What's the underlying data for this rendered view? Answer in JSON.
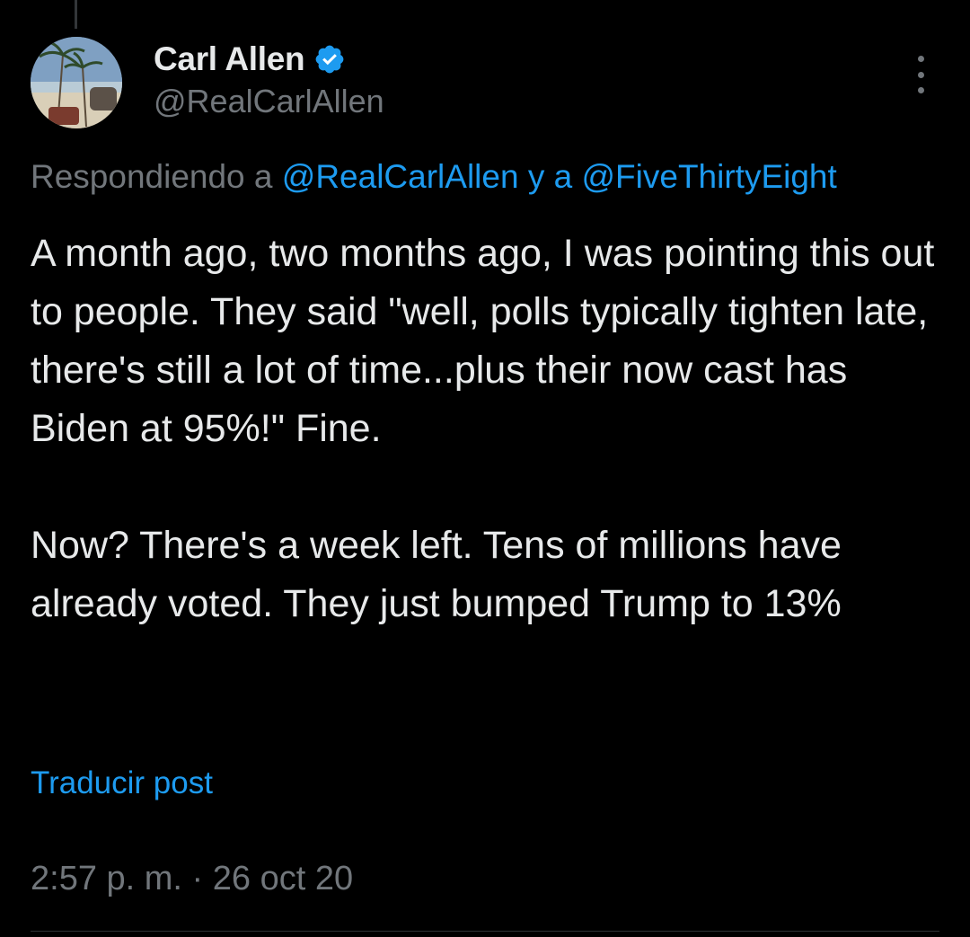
{
  "author": {
    "display_name": "Carl Allen",
    "handle": "@RealCarlAllen",
    "verified": true
  },
  "reply_context": {
    "prefix": "Respondiendo a ",
    "mention_1": "@RealCarlAllen",
    "joiner": " y a ",
    "mention_2": "@FiveThirtyEight"
  },
  "tweet": {
    "paragraph_1": "A month ago, two months ago, I was pointing this out to people. They said \"well, polls typically tighten late, there's still a lot of time...plus their now cast has Biden at 95%!\" Fine.",
    "paragraph_2": "Now? There's a week left. Tens of millions have already voted. They just bumped Trump to 13%"
  },
  "translate_label": "Traducir post",
  "timestamp": "2:57 p. m. · 26 oct 20",
  "icons": {
    "verified": "verified-badge-icon",
    "more": "more-options-icon"
  },
  "colors": {
    "background": "#000000",
    "text": "#e7e9ea",
    "secondary": "#71767b",
    "link": "#1d9bf0"
  }
}
